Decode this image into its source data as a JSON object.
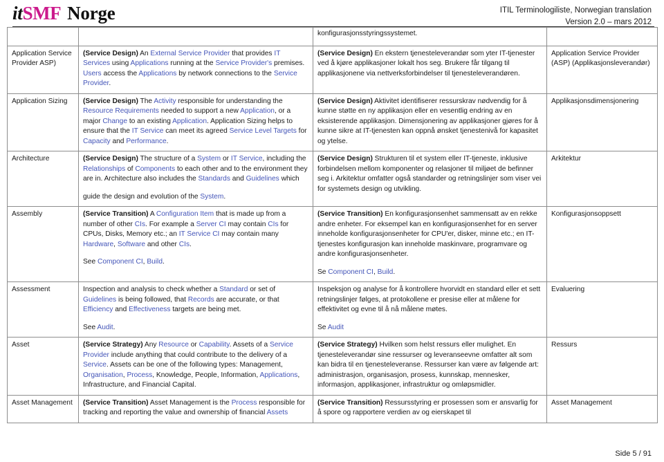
{
  "header": {
    "logo": {
      "it": "it",
      "smf": "SMF",
      "norge": "Norge"
    },
    "title": "ITIL Terminologiliste, Norwegian translation",
    "version": "Version 2.0 – mars 2012"
  },
  "colors": {
    "link": "#4455b8",
    "brand_magenta": "#cc1a8c",
    "text": "#1a1a1a",
    "border": "#8d8d8d"
  },
  "table": {
    "partial_row": {
      "term_en": "",
      "def_en": "",
      "def_no": "konfigurasjonsstyringssystemet.",
      "term_no": ""
    },
    "rows": [
      {
        "term_en": "Application Service Provider ASP)",
        "def_en_paragraphs": [
          [
            {
              "t": "(Service Design)",
              "s": "lbl"
            },
            {
              "t": " An ",
              "s": ""
            },
            {
              "t": "External Service Provider",
              "s": "lnk"
            },
            {
              "t": " that provides ",
              "s": ""
            },
            {
              "t": "IT Services",
              "s": "lnk"
            },
            {
              "t": " using ",
              "s": ""
            },
            {
              "t": "Applications",
              "s": "lnk"
            },
            {
              "t": " running at the ",
              "s": ""
            },
            {
              "t": "Service Provider's",
              "s": "lnk"
            },
            {
              "t": " premises. ",
              "s": ""
            },
            {
              "t": "Users",
              "s": "lnk"
            },
            {
              "t": " access the ",
              "s": ""
            },
            {
              "t": "Applications",
              "s": "lnk"
            },
            {
              "t": " by network connections to the ",
              "s": ""
            },
            {
              "t": "Service Provider",
              "s": "lnk"
            },
            {
              "t": ".",
              "s": ""
            }
          ]
        ],
        "def_no_paragraphs": [
          [
            {
              "t": "(Service Design)",
              "s": "lbl"
            },
            {
              "t": " En ekstern tjenesteleverandør som yter IT-tjenester ved å kjøre applikasjoner lokalt hos seg. Brukere får tilgang til applikasjonene via nettverksforbindelser til tjenesteleverandøren.",
              "s": ""
            }
          ]
        ],
        "term_no": "Application Service Provider (ASP) (Applikasjonsleverandør)"
      },
      {
        "term_en": "Application Sizing",
        "def_en_paragraphs": [
          [
            {
              "t": "(Service Design)",
              "s": "lbl"
            },
            {
              "t": " The ",
              "s": ""
            },
            {
              "t": "Activity",
              "s": "lnk"
            },
            {
              "t": " responsible for understanding the ",
              "s": ""
            },
            {
              "t": "Resource Requirements",
              "s": "lnk"
            },
            {
              "t": " needed to support a new ",
              "s": ""
            },
            {
              "t": "Application",
              "s": "lnk"
            },
            {
              "t": ", or a major ",
              "s": ""
            },
            {
              "t": "Change",
              "s": "lnk"
            },
            {
              "t": " to an existing ",
              "s": ""
            },
            {
              "t": "Application",
              "s": "lnk"
            },
            {
              "t": ". Application Sizing helps to ensure that the ",
              "s": ""
            },
            {
              "t": "IT Service",
              "s": "lnk"
            },
            {
              "t": " can meet its agreed ",
              "s": ""
            },
            {
              "t": "Service Level Targets",
              "s": "lnk"
            },
            {
              "t": " for ",
              "s": ""
            },
            {
              "t": "Capacity",
              "s": "lnk"
            },
            {
              "t": " and ",
              "s": ""
            },
            {
              "t": "Performance",
              "s": "lnk"
            },
            {
              "t": ".",
              "s": ""
            }
          ]
        ],
        "def_no_paragraphs": [
          [
            {
              "t": "(Service Design)",
              "s": "lbl"
            },
            {
              "t": " Aktivitet identifiserer ressurskrav nødvendig for å kunne støtte en ny applikasjon eller en vesentlig endring av en eksisterende applikasjon. Dimensjonering av applikasjoner gjøres for å kunne sikre at IT-tjenesten kan oppnå ønsket tjenestenivå for kapasitet og ytelse.",
              "s": ""
            }
          ]
        ],
        "term_no": "Applikasjonsdimensjonering"
      },
      {
        "term_en": "Architecture",
        "def_en_paragraphs": [
          [
            {
              "t": "(Service Design)",
              "s": "lbl"
            },
            {
              "t": " The structure of a ",
              "s": ""
            },
            {
              "t": "System",
              "s": "lnk"
            },
            {
              "t": " or ",
              "s": ""
            },
            {
              "t": "IT Service",
              "s": "lnk"
            },
            {
              "t": ", including the ",
              "s": ""
            },
            {
              "t": "Relationships",
              "s": "lnk"
            },
            {
              "t": " of ",
              "s": ""
            },
            {
              "t": "Components",
              "s": "lnk"
            },
            {
              "t": " to each other and to the environment they are in. Architecture also includes the ",
              "s": ""
            },
            {
              "t": "Standards",
              "s": "lnk"
            },
            {
              "t": " and ",
              "s": ""
            },
            {
              "t": "Guidelines",
              "s": "lnk"
            },
            {
              "t": " which",
              "s": ""
            }
          ],
          [
            {
              "t": "guide the design and evolution of the ",
              "s": ""
            },
            {
              "t": "System",
              "s": "lnk"
            },
            {
              "t": ".",
              "s": ""
            }
          ]
        ],
        "def_no_paragraphs": [
          [
            {
              "t": "(Service Design)",
              "s": "lbl"
            },
            {
              "t": " Strukturen til et system eller IT-tjeneste, inklusive forbindelsen mellom komponenter og relasjoner til miljøet de befinner seg i. Arkitektur omfatter også standarder og retningslinjer som viser vei for systemets design og utvikling.",
              "s": ""
            }
          ]
        ],
        "term_no": "Arkitektur"
      },
      {
        "term_en": "Assembly",
        "def_en_paragraphs": [
          [
            {
              "t": "(Service Transition)",
              "s": "lbl"
            },
            {
              "t": " A ",
              "s": ""
            },
            {
              "t": "Configuration Item",
              "s": "lnk"
            },
            {
              "t": " that is made up from a number of other ",
              "s": ""
            },
            {
              "t": "CIs",
              "s": "lnk"
            },
            {
              "t": ". For example a ",
              "s": ""
            },
            {
              "t": "Server CI",
              "s": "lnk"
            },
            {
              "t": " may contain ",
              "s": ""
            },
            {
              "t": "CIs",
              "s": "lnk"
            },
            {
              "t": " for CPUs, Disks, Memory etc.; an ",
              "s": ""
            },
            {
              "t": "IT Service CI",
              "s": "lnk"
            },
            {
              "t": " may contain many ",
              "s": ""
            },
            {
              "t": "Hardware",
              "s": "lnk"
            },
            {
              "t": ", ",
              "s": ""
            },
            {
              "t": "Software",
              "s": "lnk"
            },
            {
              "t": " and other ",
              "s": ""
            },
            {
              "t": "CIs",
              "s": "lnk"
            },
            {
              "t": ".",
              "s": ""
            }
          ],
          [
            {
              "t": "See ",
              "s": ""
            },
            {
              "t": "Component CI",
              "s": "lnk"
            },
            {
              "t": ", ",
              "s": ""
            },
            {
              "t": "Build",
              "s": "lnk"
            },
            {
              "t": ".",
              "s": ""
            }
          ]
        ],
        "def_no_paragraphs": [
          [
            {
              "t": "(Service Transition)",
              "s": "lbl"
            },
            {
              "t": " En konfigurasjonsenhet sammensatt av en rekke andre enheter. For eksempel kan en konfigurasjonsenhet for en server inneholde konfigurasjonsenheter for CPU'er, disker, minne etc.; en IT-tjenestes konfigurasjon kan inneholde maskinvare, programvare og andre konfigurasjonsenheter.",
              "s": ""
            }
          ],
          [
            {
              "t": "Se ",
              "s": ""
            },
            {
              "t": "Component CI",
              "s": "lnk"
            },
            {
              "t": ", ",
              "s": ""
            },
            {
              "t": "Build",
              "s": "lnk"
            },
            {
              "t": ".",
              "s": ""
            }
          ]
        ],
        "term_no": "Konfigurasjonsoppsett"
      },
      {
        "term_en": "Assessment",
        "def_en_paragraphs": [
          [
            {
              "t": "Inspection and analysis to check whether a ",
              "s": ""
            },
            {
              "t": "Standard",
              "s": "lnk"
            },
            {
              "t": " or set of ",
              "s": ""
            },
            {
              "t": "Guidelines",
              "s": "lnk"
            },
            {
              "t": " is being followed, that ",
              "s": ""
            },
            {
              "t": "Records",
              "s": "lnk"
            },
            {
              "t": " are accurate, or that ",
              "s": ""
            },
            {
              "t": "Efficiency",
              "s": "lnk"
            },
            {
              "t": " and ",
              "s": ""
            },
            {
              "t": "Effectiveness",
              "s": "lnk"
            },
            {
              "t": " targets are being met.",
              "s": ""
            }
          ],
          [
            {
              "t": "See ",
              "s": ""
            },
            {
              "t": "Audit",
              "s": "lnk"
            },
            {
              "t": ".",
              "s": ""
            }
          ]
        ],
        "def_no_paragraphs": [
          [
            {
              "t": "Inspeksjon og analyse for å kontrollere hvorvidt en standard eller et sett retningslinjer følges, at protokollene er presise eller at målene for effektivitet og evne til å nå målene møtes.",
              "s": ""
            }
          ],
          [
            {
              "t": "Se ",
              "s": ""
            },
            {
              "t": "Audit",
              "s": "lnk"
            }
          ]
        ],
        "term_no": "Evaluering"
      },
      {
        "term_en": "Asset",
        "def_en_paragraphs": [
          [
            {
              "t": "(Service Strategy)",
              "s": "lbl"
            },
            {
              "t": " Any ",
              "s": ""
            },
            {
              "t": "Resource",
              "s": "lnk"
            },
            {
              "t": " or ",
              "s": ""
            },
            {
              "t": "Capability",
              "s": "lnk"
            },
            {
              "t": ". Assets of a ",
              "s": ""
            },
            {
              "t": "Service Provider",
              "s": "lnk"
            },
            {
              "t": " include anything that could contribute to the delivery of a ",
              "s": ""
            },
            {
              "t": "Service",
              "s": "lnk"
            },
            {
              "t": ". Assets can be one of the following types: Management, ",
              "s": ""
            },
            {
              "t": "Organisation",
              "s": "lnk"
            },
            {
              "t": ", ",
              "s": ""
            },
            {
              "t": "Process",
              "s": "lnk"
            },
            {
              "t": ", Knowledge, People, Information, ",
              "s": ""
            },
            {
              "t": "Applications",
              "s": "lnk"
            },
            {
              "t": ", Infrastructure, and Financial Capital.",
              "s": ""
            }
          ]
        ],
        "def_no_paragraphs": [
          [
            {
              "t": "(Service Strategy)",
              "s": "lbl"
            },
            {
              "t": " Hvilken som helst ressurs eller mulighet. En tjenesteleverandør sine ressurser og leveranseevne omfatter alt som kan bidra til en tjenesteleveranse. Ressurser kan være av følgende art: administrasjon, organisasjon, prosess, kunnskap, mennesker, informasjon, applikasjoner, infrastruktur og omløpsmidler.",
              "s": ""
            }
          ]
        ],
        "term_no": "Ressurs"
      },
      {
        "term_en": "Asset Management",
        "def_en_paragraphs": [
          [
            {
              "t": "(Service Transition)",
              "s": "lbl"
            },
            {
              "t": " Asset Management is the ",
              "s": ""
            },
            {
              "t": "Process",
              "s": "lnk"
            },
            {
              "t": " responsible for tracking and reporting the value and ownership of financial ",
              "s": ""
            },
            {
              "t": "Assets",
              "s": "lnk"
            }
          ]
        ],
        "def_no_paragraphs": [
          [
            {
              "t": "(Service Transition)",
              "s": "lbl"
            },
            {
              "t": " Ressursstyring er prosessen som er ansvarlig for å spore og rapportere verdien av og eierskapet til",
              "s": ""
            }
          ]
        ],
        "term_no": "Asset Management"
      }
    ]
  },
  "footer": {
    "page_label": "Side 5 / 91"
  }
}
